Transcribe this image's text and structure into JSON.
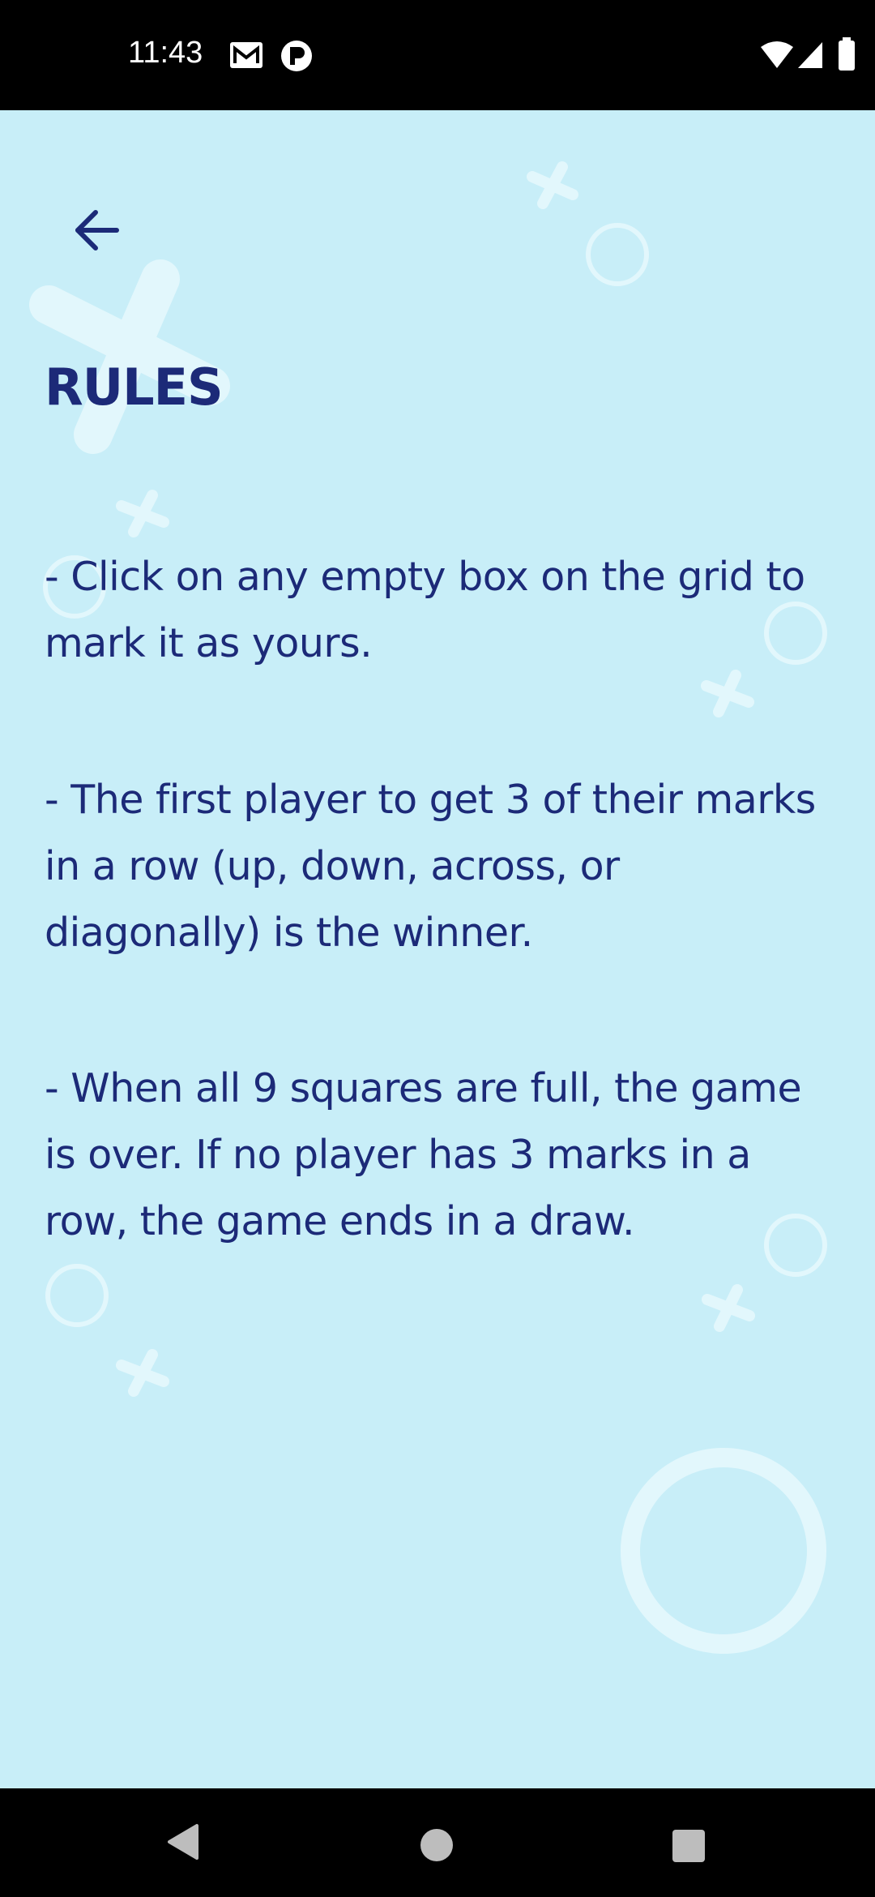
{
  "status_bar": {
    "time": "11:43",
    "left_icons": [
      "gmail-icon",
      "app-notification-icon"
    ],
    "right_icons": [
      "wifi-icon",
      "cellular-signal-icon",
      "battery-icon"
    ]
  },
  "header": {
    "back_icon": "arrow-back-icon",
    "title": "RULES"
  },
  "rules": [
    "- Click on any empty box on the grid to mark it as yours.",
    "- The first player to get 3 of their marks in a row (up, down, across, or diagonally) is the winner.",
    "- When all 9 squares are full, the game is over. If no player has 3 marks in a row, the game ends in a draw."
  ],
  "navigation_bar": {
    "buttons": [
      "back-triangle-icon",
      "home-circle-icon",
      "recents-square-icon"
    ]
  },
  "colors": {
    "background": "#c8eef8",
    "text": "#1c2a78",
    "decoration": "#e0f6fc",
    "system_bars": "#000000"
  }
}
